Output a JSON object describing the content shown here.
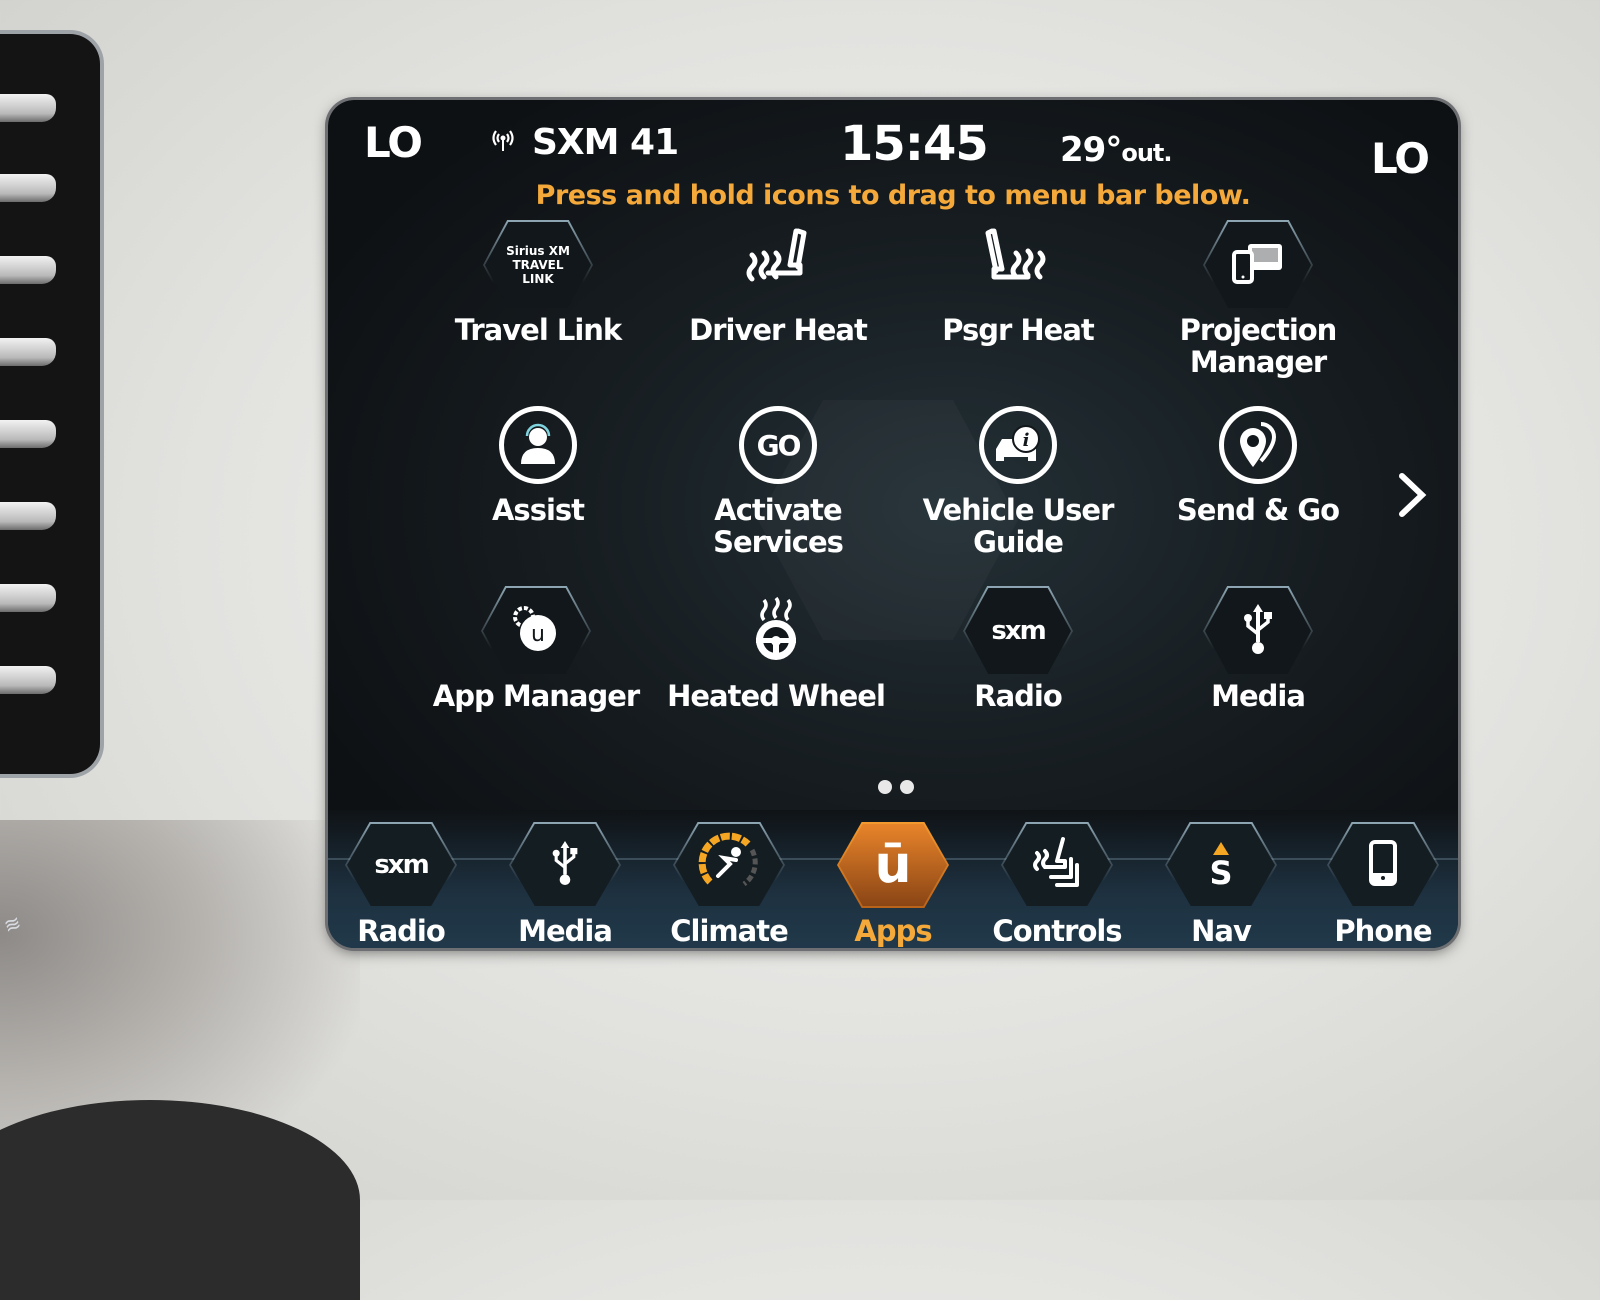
{
  "status": {
    "left_zone": "LO",
    "right_zone": "LO",
    "radio_source": "SXM 41",
    "clock": "15:45",
    "temp_value": "29°",
    "temp_suffix": "out."
  },
  "hint": "Press and hold icons to drag to menu bar below.",
  "apps": [
    {
      "label": "Travel Link",
      "icon": "siriusxm-travel-link-icon",
      "logo_lines": [
        "Sirius XM",
        "TRAVEL",
        "LINK"
      ]
    },
    {
      "label": "Driver Heat",
      "icon": "driver-seat-heat-icon"
    },
    {
      "label": "Psgr Heat",
      "icon": "passenger-seat-heat-icon"
    },
    {
      "label": "Projection Manager",
      "icon": "projection-manager-icon"
    },
    {
      "label": "Assist",
      "icon": "assist-agent-icon"
    },
    {
      "label": "Activate Services",
      "icon": "go-icon",
      "glyph": "GO"
    },
    {
      "label": "Vehicle User Guide",
      "icon": "vehicle-info-icon"
    },
    {
      "label": "Send & Go",
      "icon": "send-and-go-pin-icon"
    },
    {
      "label": "App Manager",
      "icon": "app-manager-icon"
    },
    {
      "label": "Heated Wheel",
      "icon": "heated-steering-wheel-icon"
    },
    {
      "label": "Radio",
      "icon": "sxm-radio-icon",
      "glyph": "sxm"
    },
    {
      "label": "Media",
      "icon": "usb-icon"
    }
  ],
  "pager": {
    "pages": 2,
    "current": 1
  },
  "menubar": [
    {
      "label": "Radio",
      "icon": "sxm-radio-icon",
      "glyph": "sxm",
      "active": false
    },
    {
      "label": "Media",
      "icon": "usb-icon",
      "active": false
    },
    {
      "label": "Climate",
      "icon": "climate-icon",
      "active": false
    },
    {
      "label": "Apps",
      "icon": "uconnect-apps-icon",
      "glyph": "ū",
      "active": true
    },
    {
      "label": "Controls",
      "icon": "controls-seat-icon",
      "active": false
    },
    {
      "label": "Nav",
      "icon": "nav-compass-icon",
      "glyph": "S",
      "active": false
    },
    {
      "label": "Phone",
      "icon": "phone-icon",
      "active": false
    }
  ],
  "colors": {
    "accent": "#f4a93a",
    "active_tab": "#e8842a",
    "text": "#ffffff",
    "screen_bg": "#161c20"
  }
}
